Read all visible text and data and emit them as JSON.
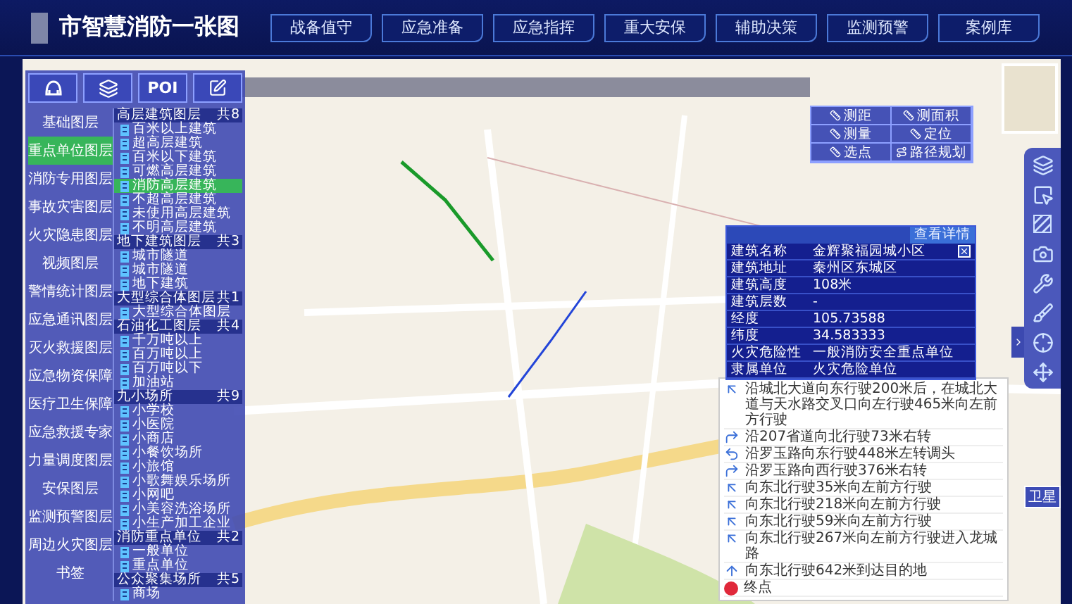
{
  "header": {
    "title": "市智慧消防一张图",
    "nav": [
      "战备值守",
      "应急准备",
      "应急指挥",
      "重大安保",
      "辅助决策",
      "监测预警",
      "案例库"
    ]
  },
  "layer_panel": {
    "tools": [
      {
        "kind": "helmet"
      },
      {
        "kind": "layers"
      },
      {
        "kind": "text",
        "label": "POI"
      },
      {
        "kind": "edit"
      }
    ],
    "categories": [
      {
        "label": "基础图层",
        "selected": false
      },
      {
        "label": "重点单位图层",
        "selected": true
      },
      {
        "label": "消防专用图层",
        "selected": false
      },
      {
        "label": "事故灾害图层",
        "selected": false
      },
      {
        "label": "火灾隐患图层",
        "selected": false
      },
      {
        "label": "视频图层",
        "selected": false
      },
      {
        "label": "警情统计图层",
        "selected": false
      },
      {
        "label": "应急通讯图层",
        "selected": false
      },
      {
        "label": "灭火救援图层",
        "selected": false
      },
      {
        "label": "应急物资保障",
        "selected": false
      },
      {
        "label": "医疗卫生保障",
        "selected": false
      },
      {
        "label": "应急救援专家",
        "selected": false
      },
      {
        "label": "力量调度图层",
        "selected": false
      },
      {
        "label": "安保图层",
        "selected": false
      },
      {
        "label": "监测预警图层",
        "selected": false
      },
      {
        "label": "周边火灾图层",
        "selected": false
      },
      {
        "label": "书签",
        "selected": false
      }
    ],
    "groups": [
      {
        "title": "高层建筑图层",
        "count": "共8",
        "items": [
          {
            "label": "百米以上建筑",
            "selected": false
          },
          {
            "label": "超高层建筑",
            "selected": false
          },
          {
            "label": "百米以下建筑",
            "selected": false
          },
          {
            "label": "可燃高层建筑",
            "selected": false
          },
          {
            "label": "消防高层建筑",
            "selected": true
          },
          {
            "label": "不超高层建筑",
            "selected": false
          },
          {
            "label": "未使用高层建筑",
            "selected": false
          },
          {
            "label": "不明高层建筑",
            "selected": false
          }
        ]
      },
      {
        "title": "地下建筑图层",
        "count": "共3",
        "items": [
          {
            "label": "城市隧道",
            "selected": false
          },
          {
            "label": "城市隧道",
            "selected": false
          },
          {
            "label": "地下建筑",
            "selected": false
          }
        ]
      },
      {
        "title": "大型综合体图层",
        "count": "共1",
        "items": [
          {
            "label": "大型综合体图层",
            "selected": false
          }
        ]
      },
      {
        "title": "石油化工图层",
        "count": "共4",
        "items": [
          {
            "label": "千万吨以上",
            "selected": false
          },
          {
            "label": "百万吨以上",
            "selected": false
          },
          {
            "label": "百万吨以下",
            "selected": false
          },
          {
            "label": "加油站",
            "selected": false
          }
        ]
      },
      {
        "title": "九小场所",
        "count": "共9",
        "items": [
          {
            "label": "小学校",
            "selected": false
          },
          {
            "label": "小医院",
            "selected": false
          },
          {
            "label": "小商店",
            "selected": false
          },
          {
            "label": "小餐饮场所",
            "selected": false
          },
          {
            "label": "小旅馆",
            "selected": false
          },
          {
            "label": "小歌舞娱乐场所",
            "selected": false
          },
          {
            "label": "小网吧",
            "selected": false
          },
          {
            "label": "小美容洗浴场所",
            "selected": false
          },
          {
            "label": "小生产加工企业",
            "selected": false
          }
        ]
      },
      {
        "title": "消防重点单位",
        "count": "共2",
        "items": [
          {
            "label": "一般单位",
            "selected": false
          },
          {
            "label": "重点单位",
            "selected": false
          }
        ]
      },
      {
        "title": "公众聚集场所",
        "count": "共5",
        "items": [
          {
            "label": "商场",
            "selected": false
          }
        ]
      }
    ]
  },
  "map": {
    "tools": [
      {
        "kind": "measure",
        "label": "测距"
      },
      {
        "kind": "measure",
        "label": "测面积"
      },
      {
        "kind": "measure",
        "label": "测量"
      },
      {
        "kind": "measure",
        "label": "定位"
      },
      {
        "kind": "measure",
        "label": "选点"
      },
      {
        "kind": "route",
        "label": "路径规划"
      }
    ],
    "side_tools": [
      {
        "kind": "layers"
      },
      {
        "kind": "select"
      },
      {
        "kind": "hatch"
      },
      {
        "kind": "camera"
      },
      {
        "kind": "wrench"
      },
      {
        "kind": "brush"
      },
      {
        "kind": "target"
      },
      {
        "kind": "move"
      }
    ],
    "basemap_button": "卫星"
  },
  "popup": {
    "link": "查看详情",
    "rows": [
      {
        "label": "建筑名称",
        "value": "金辉聚福园城小区"
      },
      {
        "label": "建筑地址",
        "value": "秦州区东城区"
      },
      {
        "label": "建筑高度",
        "value": "108米"
      },
      {
        "label": "建筑层数",
        "value": "-"
      },
      {
        "label": "经度",
        "value": "105.73588"
      },
      {
        "label": "纬度",
        "value": "34.583333"
      },
      {
        "label": "火灾危险性",
        "value": "一般消防安全重点单位"
      },
      {
        "label": "隶属单位",
        "value": "火灾危险单位"
      }
    ]
  },
  "route": {
    "steps": [
      {
        "kind": "bear-left",
        "text": "沿城北大道向东行驶200米后，在城北大道与天水路交叉口向左行驶465米向左前方行驶"
      },
      {
        "kind": "turn-right",
        "text": "沿207省道向北行驶73米右转"
      },
      {
        "kind": "u-turn",
        "text": "沿罗玉路向东行驶448米左转调头"
      },
      {
        "kind": "turn-right",
        "text": "沿罗玉路向西行驶376米右转"
      },
      {
        "kind": "bear-left",
        "text": "向东北行驶35米向左前方行驶"
      },
      {
        "kind": "bear-left",
        "text": "向东北行驶218米向左前方行驶"
      },
      {
        "kind": "bear-left",
        "text": "向东北行驶59米向左前方行驶"
      },
      {
        "kind": "bear-left",
        "text": "向东北行驶267米向左前方行驶进入龙城路"
      },
      {
        "kind": "straight",
        "text": "向东北行驶642米到达目的地"
      },
      {
        "kind": "end",
        "text": "终点"
      }
    ]
  }
}
